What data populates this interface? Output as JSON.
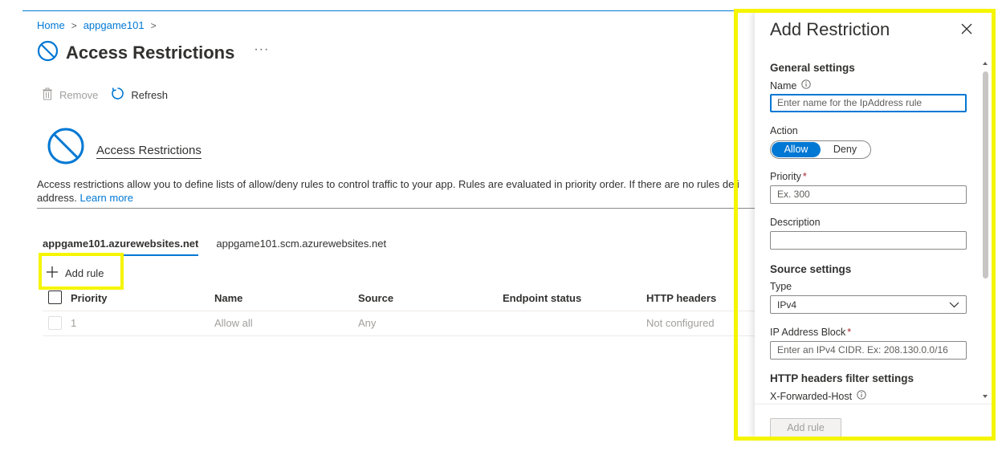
{
  "breadcrumb": {
    "home": "Home",
    "app": "appgame101"
  },
  "page": {
    "title": "Access Restrictions",
    "more": "···"
  },
  "toolbar": {
    "remove": "Remove",
    "refresh": "Refresh"
  },
  "hero": {
    "title": "Access Restrictions"
  },
  "description": {
    "text": "Access restrictions allow you to define lists of allow/deny rules to control traffic to your app. Rules are evaluated in priority order. If there are no rules defi",
    "text2": "address.",
    "link": "Learn more"
  },
  "tabs": [
    {
      "label": "appgame101.azurewebsites.net",
      "active": true
    },
    {
      "label": "appgame101.scm.azurewebsites.net",
      "active": false
    }
  ],
  "add_rule": {
    "label": "Add rule"
  },
  "table": {
    "headers": {
      "priority": "Priority",
      "name": "Name",
      "source": "Source",
      "endpoint": "Endpoint status",
      "http": "HTTP headers"
    },
    "rows": [
      {
        "priority": "1",
        "name": "Allow all",
        "source": "Any",
        "endpoint": "",
        "http": "Not configured"
      }
    ]
  },
  "panel": {
    "title": "Add Restriction",
    "general_settings": "General settings",
    "name_label": "Name",
    "name_placeholder": "Enter name for the IpAddress rule",
    "action_label": "Action",
    "action_options": [
      "Allow",
      "Deny"
    ],
    "action_selected": "Allow",
    "priority_label": "Priority",
    "priority_required": "*",
    "priority_placeholder": "Ex. 300",
    "description_label": "Description",
    "description_value": "",
    "source_settings": "Source settings",
    "type_label": "Type",
    "type_value": "IPv4",
    "ip_block_label": "IP Address Block",
    "ip_block_required": "*",
    "ip_block_placeholder": "Enter an IPv4 CIDR. Ex: 208.130.0.0/16",
    "http_filter_settings": "HTTP headers filter settings",
    "x_forwarded_host_label": "X-Forwarded-Host",
    "submit_label": "Add rule"
  },
  "colors": {
    "accent": "#0078d4",
    "highlight": "#f5f500",
    "required": "#a4262c"
  }
}
